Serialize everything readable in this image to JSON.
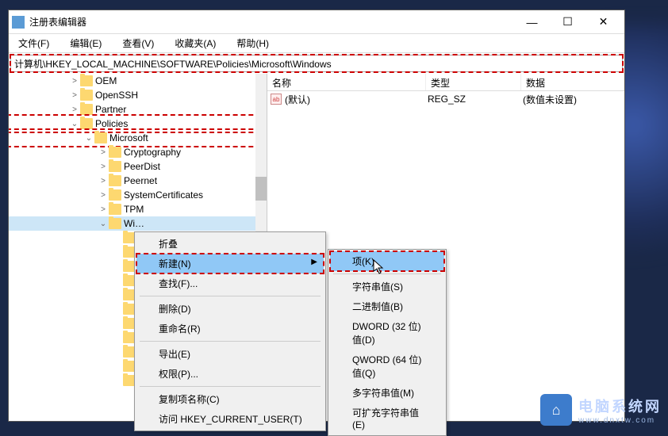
{
  "window": {
    "title": "注册表编辑器",
    "controls": {
      "min": "—",
      "max": "☐",
      "close": "✕"
    }
  },
  "menubar": [
    "文件(F)",
    "编辑(E)",
    "查看(V)",
    "收藏夹(A)",
    "帮助(H)"
  ],
  "address": "计算机\\HKEY_LOCAL_MACHINE\\SOFTWARE\\Policies\\Microsoft\\Windows",
  "tree": [
    {
      "indent": 76,
      "expander": ">",
      "label": "OEM"
    },
    {
      "indent": 76,
      "expander": ">",
      "label": "OpenSSH"
    },
    {
      "indent": 76,
      "expander": ">",
      "label": "Partner"
    },
    {
      "indent": 76,
      "expander": "v",
      "label": "Policies",
      "highlight": "policies"
    },
    {
      "indent": 94,
      "expander": "v",
      "label": "Microsoft",
      "highlight": "microsoft"
    },
    {
      "indent": 112,
      "expander": ">",
      "label": "Cryptography"
    },
    {
      "indent": 112,
      "expander": ">",
      "label": "PeerDist"
    },
    {
      "indent": 112,
      "expander": ">",
      "label": "Peernet"
    },
    {
      "indent": 112,
      "expander": ">",
      "label": "SystemCertificates"
    },
    {
      "indent": 112,
      "expander": ">",
      "label": "TPM"
    },
    {
      "indent": 112,
      "expander": "v",
      "label": "Wi…",
      "selected": true
    },
    {
      "indent": 130,
      "expander": "",
      "label": ""
    },
    {
      "indent": 130,
      "expander": "",
      "label": ""
    },
    {
      "indent": 130,
      "expander": "",
      "label": ""
    },
    {
      "indent": 130,
      "expander": "",
      "label": ""
    },
    {
      "indent": 130,
      "expander": "",
      "label": ""
    },
    {
      "indent": 130,
      "expander": "",
      "label": ""
    },
    {
      "indent": 130,
      "expander": "",
      "label": ""
    },
    {
      "indent": 130,
      "expander": "",
      "label": ""
    },
    {
      "indent": 130,
      "expander": "",
      "label": ""
    },
    {
      "indent": 130,
      "expander": "",
      "label": ""
    },
    {
      "indent": 130,
      "expander": "",
      "label": ""
    }
  ],
  "list": {
    "headers": {
      "name": "名称",
      "type": "类型",
      "data": "数据"
    },
    "rows": [
      {
        "icon": "ab",
        "name": "(默认)",
        "type": "REG_SZ",
        "data": "(数值未设置)"
      }
    ]
  },
  "context_main": [
    {
      "label": "折叠",
      "kind": "item"
    },
    {
      "label": "新建(N)",
      "kind": "item",
      "highlight": true,
      "submenu": true
    },
    {
      "label": "查找(F)...",
      "kind": "item"
    },
    {
      "kind": "sep"
    },
    {
      "label": "删除(D)",
      "kind": "item"
    },
    {
      "label": "重命名(R)",
      "kind": "item"
    },
    {
      "kind": "sep"
    },
    {
      "label": "导出(E)",
      "kind": "item"
    },
    {
      "label": "权限(P)...",
      "kind": "item"
    },
    {
      "kind": "sep"
    },
    {
      "label": "复制项名称(C)",
      "kind": "item"
    },
    {
      "label": "访问 HKEY_CURRENT_USER(T)",
      "kind": "item"
    }
  ],
  "context_sub": [
    {
      "label": "项(K)",
      "highlight": true
    },
    {
      "kind": "sep"
    },
    {
      "label": "字符串值(S)"
    },
    {
      "label": "二进制值(B)"
    },
    {
      "label": "DWORD (32 位)值(D)"
    },
    {
      "label": "QWORD (64 位)值(Q)"
    },
    {
      "label": "多字符串值(M)"
    },
    {
      "label": "可扩充字符串值(E)"
    }
  ],
  "watermark": {
    "title": "电脑系统网",
    "url": "www.dnxtw.com"
  }
}
